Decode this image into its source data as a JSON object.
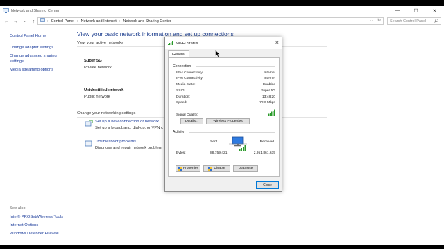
{
  "window": {
    "title": "Network and Sharing Center",
    "controls": {
      "minimize": "—",
      "maximize": "☐",
      "close": "✕"
    }
  },
  "address": {
    "crumbs": [
      "Control Panel",
      "Network and Internet",
      "Network and Sharing Center"
    ],
    "search_placeholder": "Search Control Panel"
  },
  "leftnav": {
    "home": "Control Panel Home",
    "links": [
      "Change adapter settings",
      "Change advanced sharing settings",
      "Media streaming options"
    ],
    "see_also_header": "See also",
    "see_also": [
      "Intel® PROSet/Wireless Tools",
      "Internet Options",
      "Windows Defender Firewall"
    ]
  },
  "main": {
    "heading": "View your basic network information and set up connections",
    "active_header": "View your active networks",
    "networks": [
      {
        "name": "Super 5G",
        "type": "Private network"
      },
      {
        "name": "Unidentified network",
        "type": "Public network"
      }
    ],
    "change_header": "Change your networking settings",
    "tasks": [
      {
        "link": "Set up a new connection or network",
        "desc": "Set up a broadband, dial-up, or VPN c"
      },
      {
        "link": "Troubleshoot problems",
        "desc": "Diagnose and repair network problem"
      }
    ]
  },
  "dialog": {
    "title": "Wi-Fi Status",
    "tab": "General",
    "connection_header": "Connection",
    "rows": [
      {
        "label": "IPv4 Connectivity:",
        "value": "Internet"
      },
      {
        "label": "IPv6 Connectivity:",
        "value": "Internet"
      },
      {
        "label": "Media State:",
        "value": "Enabled"
      },
      {
        "label": "SSID:",
        "value": "Super 5G"
      },
      {
        "label": "Duration:",
        "value": "13:48:20"
      },
      {
        "label": "Speed:",
        "value": "72.0 Mbps"
      }
    ],
    "signal_label": "Signal Quality:",
    "details_button": "Details...",
    "wireless_button": "Wireless Properties",
    "activity_header": "Activity",
    "sent_label": "Sent",
    "received_label": "Received",
    "bytes_label": "Bytes:",
    "bytes_sent": "88,759,421",
    "bytes_received": "2,951,861,635",
    "properties_button": "Properties",
    "disable_button": "Disable",
    "diagnose_button": "Diagnose",
    "close_button": "Close"
  },
  "colors": {
    "link": "#1a3b9a",
    "heading": "#1e3f8f",
    "signal": "#2a9a2a",
    "close_border": "#0078d7"
  },
  "icons": [
    "network-icon",
    "wifi-signal-icon",
    "shield-icon",
    "back-icon",
    "forward-icon",
    "up-icon",
    "search-icon",
    "refresh-icon",
    "cursor-icon",
    "network-activity-icon"
  ]
}
